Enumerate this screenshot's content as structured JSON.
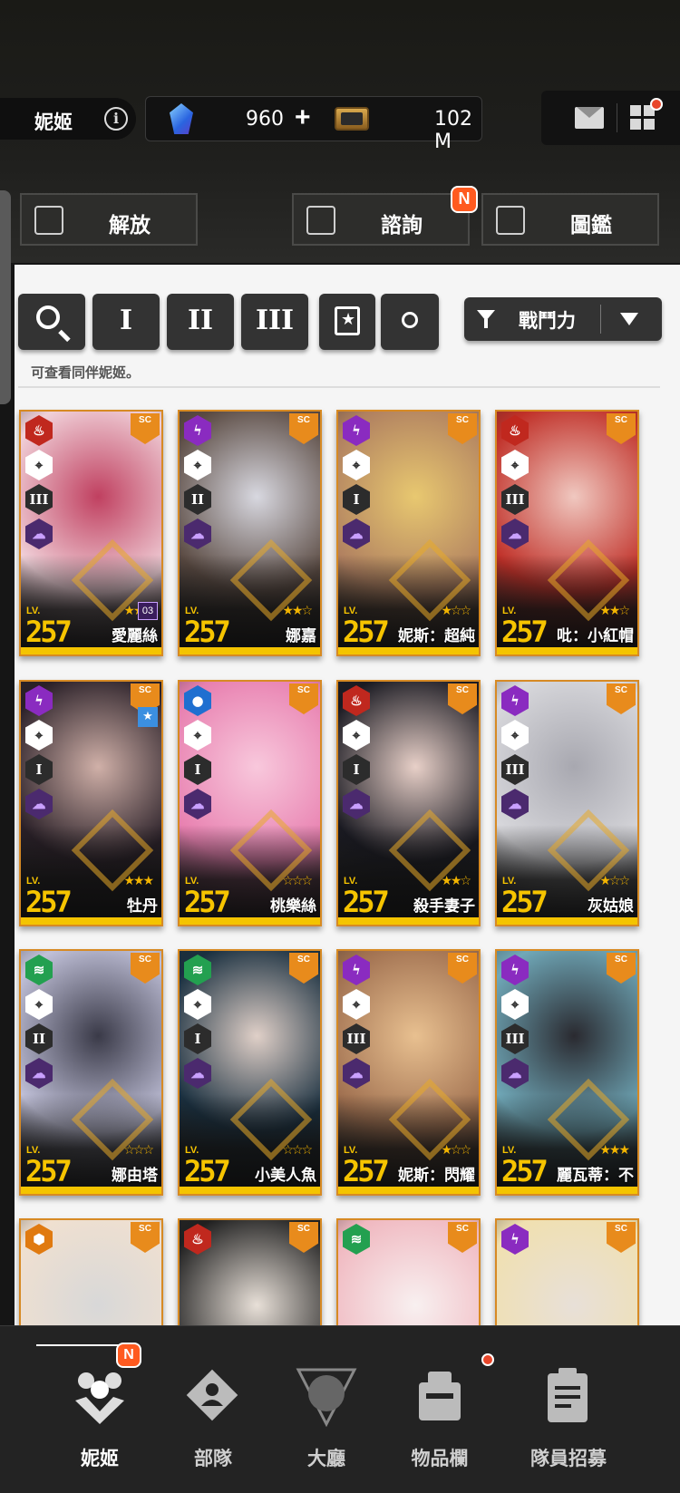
{
  "header": {
    "title": "妮姬",
    "info_icon": "info-icon",
    "gems": "960",
    "plus": "+",
    "credits": "102 M",
    "mail_icon": "mail-icon",
    "menu_icon": "grid-menu-icon"
  },
  "top_buttons": {
    "release": "解放",
    "consult": "諮詢",
    "consult_badge": "N",
    "codex": "圖鑑"
  },
  "filters": {
    "search_icon": "search-icon",
    "burst_1": "I",
    "burst_2": "II",
    "burst_3": "III",
    "favorite_icon": "favorite-icon",
    "circle_icon": "circle-icon",
    "sort_label": "戰鬥力",
    "hint": "可查看同伴妮姬。"
  },
  "colors": {
    "fire": "#c0281e",
    "electric": "#8a2bc0",
    "water": "#1f6fd0",
    "wind": "#23a050",
    "iron": "#e07a10",
    "card_border": "#d78a24",
    "level": "#f6c400",
    "badge": "#ff5a1f"
  },
  "cards": [
    {
      "name": "愛麗絲",
      "level": "257",
      "lv_label": "LV.",
      "element": "fire",
      "weapon": "⌖",
      "burst": "III",
      "stars": 3,
      "badge": "03",
      "art": [
        "#f0d0d8",
        "#c04060"
      ]
    },
    {
      "name": "娜嘉",
      "level": "257",
      "lv_label": "LV.",
      "element": "electric",
      "weapon": "⌖",
      "burst": "II",
      "stars": 2,
      "art": [
        "#5a4a42",
        "#d8d8e0"
      ]
    },
    {
      "name": "妮斯：超純",
      "level": "257",
      "lv_label": "LV.",
      "element": "electric",
      "weapon": "⌖",
      "burst": "I",
      "stars": 1,
      "art": [
        "#b08060",
        "#e8c870"
      ]
    },
    {
      "name": "吡：小紅帽",
      "level": "257",
      "lv_label": "LV.",
      "element": "fire",
      "weapon": "⌖",
      "burst": "III",
      "stars": 2,
      "art": [
        "#c03028",
        "#f0c8c0"
      ]
    },
    {
      "name": "牡丹",
      "level": "257",
      "lv_label": "LV.",
      "element": "electric",
      "weapon": "⌖",
      "burst": "I",
      "stars": 3,
      "fav": "★",
      "art": [
        "#2a2028",
        "#d0b0a8"
      ]
    },
    {
      "name": "桃樂絲",
      "level": "257",
      "lv_label": "LV.",
      "element": "water",
      "weapon": "⌖",
      "burst": "I",
      "stars": 0,
      "art": [
        "#e880b0",
        "#f8c8dc"
      ]
    },
    {
      "name": "殺手妻子",
      "level": "257",
      "lv_label": "LV.",
      "element": "fire",
      "weapon": "⌖",
      "burst": "I",
      "stars": 2,
      "art": [
        "#1a1a22",
        "#e8d0c8"
      ]
    },
    {
      "name": "灰姑娘",
      "level": "257",
      "lv_label": "LV.",
      "element": "electric",
      "weapon": "⌖",
      "burst": "III",
      "stars": 1,
      "art": [
        "#d8d8dc",
        "#a8a8b0"
      ]
    },
    {
      "name": "娜由塔",
      "level": "257",
      "lv_label": "LV.",
      "element": "wind",
      "weapon": "⌖",
      "burst": "II",
      "stars": 0,
      "art": [
        "#c0c0d8",
        "#3a3a48"
      ]
    },
    {
      "name": "小美人魚",
      "level": "257",
      "lv_label": "LV.",
      "element": "wind",
      "weapon": "⌖",
      "burst": "I",
      "stars": 0,
      "art": [
        "#1a3040",
        "#e0d0c8"
      ]
    },
    {
      "name": "妮斯：閃耀",
      "level": "257",
      "lv_label": "LV.",
      "element": "electric",
      "weapon": "⌖",
      "burst": "III",
      "stars": 1,
      "art": [
        "#a07050",
        "#e8c090"
      ]
    },
    {
      "name": "麗瓦蒂：不",
      "level": "257",
      "lv_label": "LV.",
      "element": "electric",
      "weapon": "⌖",
      "burst": "III",
      "stars": 3,
      "art": [
        "#70a8b8",
        "#2a2a30"
      ]
    },
    {
      "name": "",
      "level": "",
      "lv_label": "",
      "element": "iron",
      "weapon": "",
      "burst": "",
      "stars": 0,
      "art": [
        "#f0e0d0",
        "#d8d8d8"
      ]
    },
    {
      "name": "",
      "level": "",
      "lv_label": "",
      "element": "fire",
      "weapon": "",
      "burst": "",
      "stars": 0,
      "art": [
        "#202020",
        "#e8e0d8"
      ]
    },
    {
      "name": "",
      "level": "",
      "lv_label": "",
      "element": "wind",
      "weapon": "",
      "burst": "",
      "stars": 0,
      "art": [
        "#f0b8c0",
        "#f8f0f0"
      ]
    },
    {
      "name": "",
      "level": "",
      "lv_label": "",
      "element": "electric",
      "weapon": "",
      "burst": "",
      "stars": 0,
      "art": [
        "#f0e0b0",
        "#e8e0d8"
      ]
    }
  ],
  "bottom_nav": [
    {
      "label": "妮姬",
      "icon": "nikke-icon",
      "badge": "N",
      "active": true
    },
    {
      "label": "部隊",
      "icon": "squad-icon",
      "active": false
    },
    {
      "label": "大廳",
      "icon": "lobby-icon",
      "active": false
    },
    {
      "label": "物品欄",
      "icon": "inventory-icon",
      "dot": true,
      "active": false
    },
    {
      "label": "隊員招募",
      "icon": "recruit-icon",
      "active": false
    }
  ]
}
